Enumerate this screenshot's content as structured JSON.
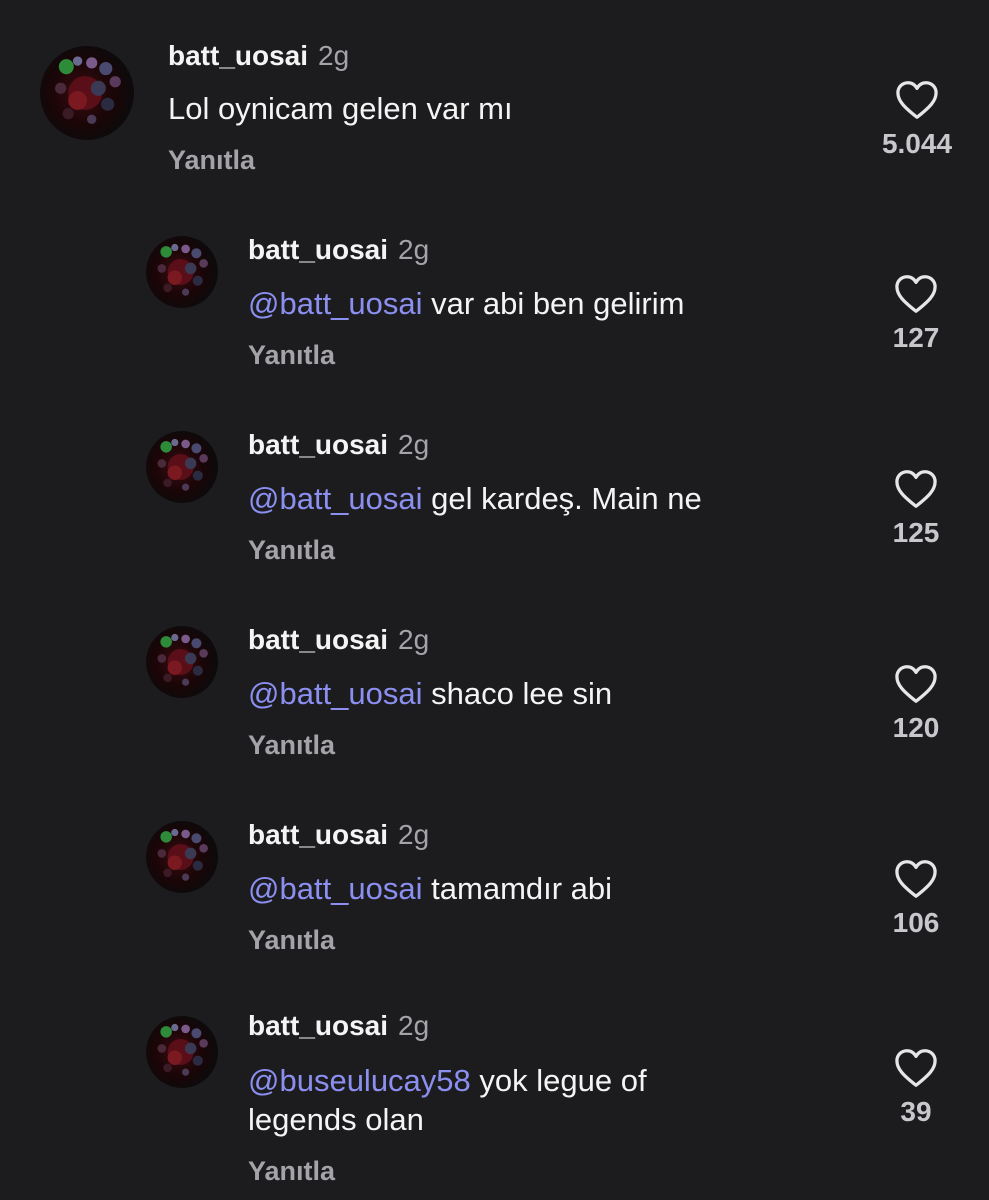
{
  "comments": [
    {
      "username": "batt_uosai",
      "time": "2g",
      "mention": "",
      "text": "Lol oynicam gelen var mı",
      "reply_label": "Yanıtla",
      "likes": "5.044"
    },
    {
      "username": "batt_uosai",
      "time": "2g",
      "mention": "@batt_uosai",
      "text": "var abi ben gelirim",
      "reply_label": "Yanıtla",
      "likes": "127"
    },
    {
      "username": "batt_uosai",
      "time": "2g",
      "mention": "@batt_uosai",
      "text": "gel kardeş. Main ne",
      "reply_label": "Yanıtla",
      "likes": "125"
    },
    {
      "username": "batt_uosai",
      "time": "2g",
      "mention": "@batt_uosai",
      "text": "shaco lee sin",
      "reply_label": "Yanıtla",
      "likes": "120"
    },
    {
      "username": "batt_uosai",
      "time": "2g",
      "mention": "@batt_uosai",
      "text": "tamamdır abi",
      "reply_label": "Yanıtla",
      "likes": "106"
    },
    {
      "username": "batt_uosai",
      "time": "2g",
      "mention": "@buseulucay58",
      "text": "yok legue of legends olan",
      "reply_label": "Yanıtla",
      "likes": "39"
    }
  ],
  "icons": {
    "avatar": "avatar-icon",
    "like": "heart-outline-icon"
  },
  "colors": {
    "background": "#1c1c1f",
    "mention": "#8b8ff0",
    "secondary_text": "#a3a3a8"
  }
}
